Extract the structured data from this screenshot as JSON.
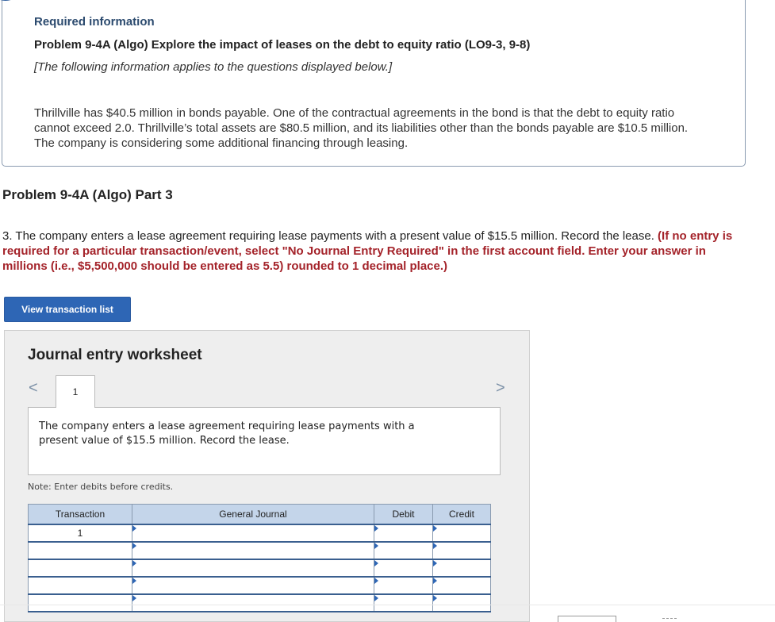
{
  "info": {
    "required_title": "Required information",
    "problem_title": "Problem 9-4A (Algo) Explore the impact of leases on the debt to equity ratio (LO9-3, 9-8)",
    "problem_note": "[The following information applies to the questions displayed below.]",
    "problem_text": "Thrillville has $40.5 million in bonds payable. One of the contractual agreements in the bond is that the debt to equity ratio cannot exceed 2.0. Thrillville’s total assets are $80.5 million, and its liabilities other than the bonds payable are $10.5 million. The company is considering some additional financing through leasing."
  },
  "part": {
    "title": "Problem 9-4A (Algo) Part 3",
    "question_text": "3. The company enters a lease agreement requiring lease payments with a present value of $15.5 million. Record the lease. ",
    "question_instruction": "(If no entry is required for a particular transaction/event, select \"No Journal Entry Required\" in the first account field. Enter your answer in millions (i.e., $5,500,000 should be entered as 5.5) rounded to 1 decimal place.)"
  },
  "buttons": {
    "view_transaction_list": "View transaction list"
  },
  "worksheet": {
    "title": "Journal entry worksheet",
    "prev_glyph": "<",
    "next_glyph": ">",
    "tab_label": "1",
    "description": "The company enters a lease agreement requiring lease payments with a present value of $15.5 million. Record the lease.",
    "note": "Note: Enter debits before credits.",
    "columns": {
      "transaction": "Transaction",
      "general_journal": "General Journal",
      "debit": "Debit",
      "credit": "Credit"
    },
    "rows": [
      {
        "transaction": "1",
        "account": "",
        "debit": "",
        "credit": ""
      },
      {
        "transaction": "",
        "account": "",
        "debit": "",
        "credit": ""
      },
      {
        "transaction": "",
        "account": "",
        "debit": "",
        "credit": ""
      },
      {
        "transaction": "",
        "account": "",
        "debit": "",
        "credit": ""
      },
      {
        "transaction": "",
        "account": "",
        "debit": "",
        "credit": ""
      }
    ]
  },
  "colors": {
    "accent_blue": "#2e66b5",
    "header_blue": "#c4d5ea",
    "instruction_red": "#a4232a"
  }
}
